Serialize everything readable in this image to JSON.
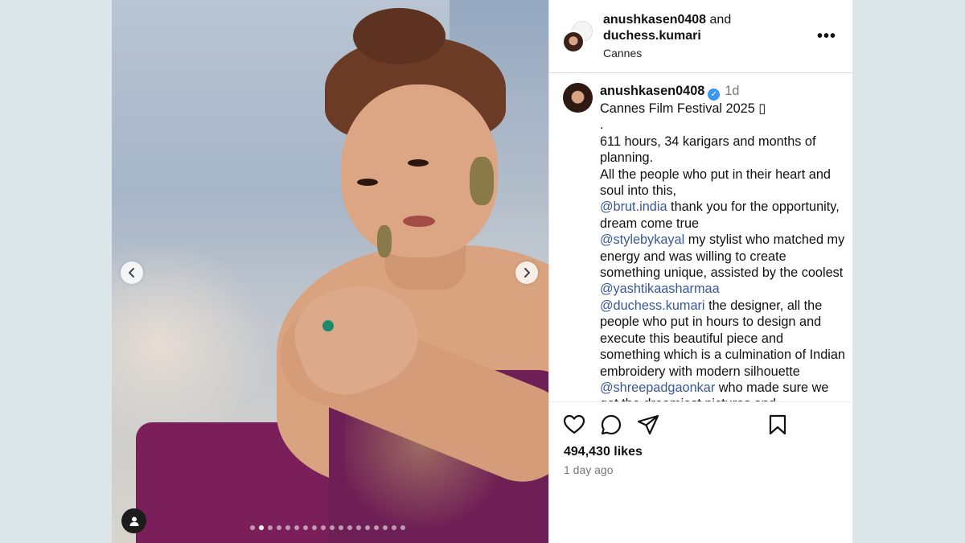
{
  "post": {
    "carousel": {
      "slide_count": 18,
      "active_index": 1,
      "prev_icon": "chevron-left-icon",
      "next_icon": "chevron-right-icon",
      "tag_icon": "person-icon"
    },
    "header": {
      "user1": "anushkasen0408",
      "and_text": " and",
      "user2": "duchess.kumari",
      "location": "Cannes",
      "more_label": "•••"
    },
    "caption": {
      "username": "anushkasen0408",
      "verified_mark": "✓",
      "time": "1d",
      "line1": "Cannes Film Festival 2025 ▯",
      "line2": ".",
      "line3": "611 hours, 34 karigars and months of planning.",
      "line4": "All the people who put in their heart and soul into this,",
      "mention1": "@brut.india",
      "line5": " thank you for the opportunity, dream come true",
      "mention2": "@stylebykayal",
      "line6": " my stylist who matched my energy and was willing to create something unique, assisted by the coolest",
      "mention3": "@yashtikaasharmaa",
      "mention4": "@duchess.kumari",
      "line7": " the designer, all the people who put in hours to design and execute this beautiful piece and something which is a culmination of Indian embroidery with modern silhouette",
      "mention5": "@shreepadgaonkar",
      "line8": " who made sure we got the dreamiest pictures and"
    },
    "actions": {
      "like_icon": "heart-icon",
      "comment_icon": "comment-icon",
      "share_icon": "send-icon",
      "save_icon": "bookmark-icon"
    },
    "likes": "494,430 likes",
    "posted": "1 day ago"
  }
}
